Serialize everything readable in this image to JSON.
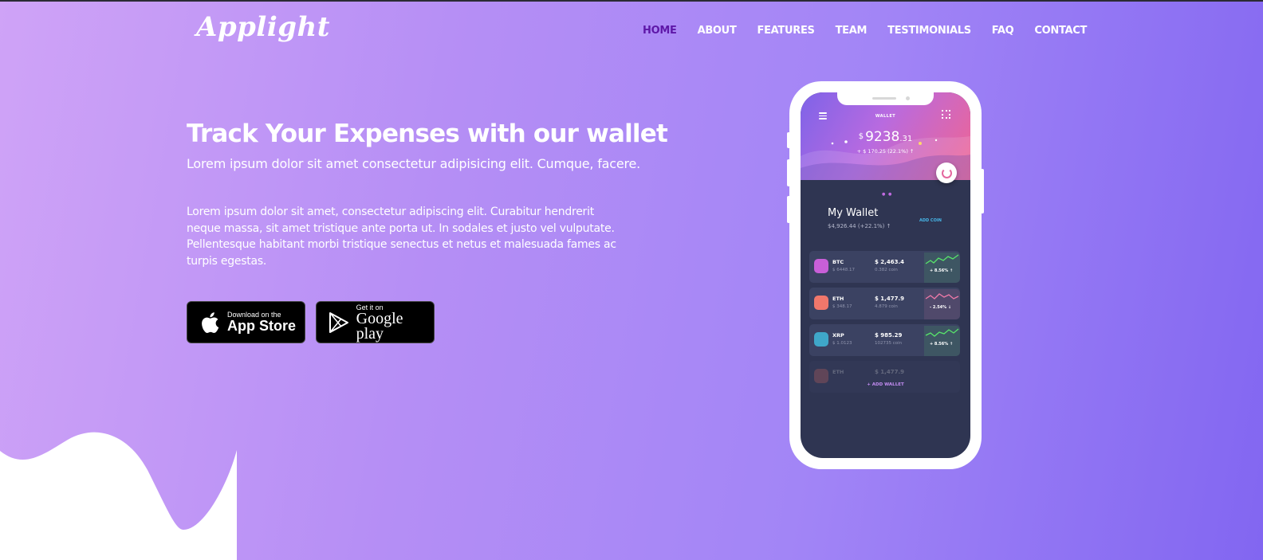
{
  "brand": {
    "logo_text": "Applight"
  },
  "nav": {
    "items": [
      {
        "label": "HOME",
        "active": true
      },
      {
        "label": "ABOUT"
      },
      {
        "label": "FEATURES"
      },
      {
        "label": "TEAM"
      },
      {
        "label": "TESTIMONIALS"
      },
      {
        "label": "FAQ"
      },
      {
        "label": "CONTACT"
      }
    ]
  },
  "hero": {
    "title": "Track Your Expenses with our wallet",
    "subtitle": "Lorem ipsum dolor sit amet consectetur adipisicing elit. Cumque, facere.",
    "body_lines": [
      "Lorem ipsum dolor sit amet, consectetur adipiscing elit. Curabitur hendrerit",
      "neque massa, sit amet tristique ante porta ut. In sodales et justo vel vulputate.",
      "Pellentesque habitant morbi tristique senectus et netus et malesuada fames ac",
      "turpis egestas."
    ]
  },
  "buttons": {
    "app_store": {
      "small": "Download on the",
      "big": "App Store",
      "icon": "apple-icon"
    },
    "google_play": {
      "small": "Get it on",
      "big": "Google play",
      "icon": "play-icon"
    }
  },
  "phone": {
    "screen_title": "WALLET",
    "balance_currency": "$",
    "balance_main": "9238",
    "balance_decimals": ".31",
    "balance_change": "+ $ 170.25 (22.1%) ↑",
    "wallet_title": "My Wallet",
    "wallet_sub": "$4,926.44 (+22.1%) ↑",
    "add_coin": "ADD COIN",
    "add_wallet": "+ ADD WALLET",
    "coins": [
      {
        "name": "BTC",
        "price": "$ 6448.17",
        "value": "$ 2,463.4",
        "amount": "0.382 coin",
        "pct": "+ 8.56% ↑",
        "color": "#c85fd8",
        "trend": "up"
      },
      {
        "name": "ETH",
        "price": "$ 348.17",
        "value": "$ 1,477.9",
        "amount": "4.879 coin",
        "pct": "- 2.54% ↓",
        "color": "#f0776b",
        "trend": "down"
      },
      {
        "name": "XRP",
        "price": "$ 1.0123",
        "value": "$ 985.29",
        "amount": "102735 coin",
        "pct": "+ 8.56% ↑",
        "color": "#3fa7c9",
        "trend": "up"
      },
      {
        "name": "ETH",
        "price": "",
        "value": "$ 1,477.9",
        "amount": "",
        "pct": "",
        "color": "#f0776b",
        "trend": "down"
      }
    ]
  },
  "colors": {
    "nav_active": "#5e17a8",
    "gradient_start": "#cfa3f7",
    "gradient_end": "#8266f1",
    "up": "#58e56b",
    "down": "#f07aa9"
  }
}
